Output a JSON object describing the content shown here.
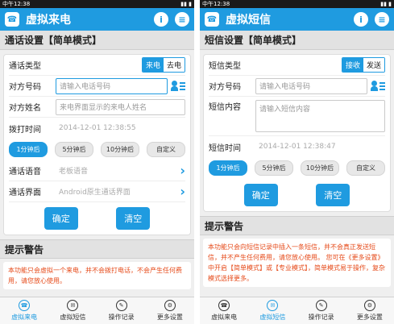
{
  "status": {
    "time": "中午12:38",
    "indicators": "▮▮ ▮"
  },
  "left": {
    "title": "虚拟来电",
    "section": "通话设置【简单模式】",
    "type_label": "通话类型",
    "type_on": "来电",
    "type_off": "去电",
    "number_label": "对方号码",
    "number_placeholder": "请输入电话号码",
    "name_label": "对方姓名",
    "name_placeholder": "来电界面显示的来电人姓名",
    "time_label": "拨打时间",
    "time_value": "2014-12-01 12:38:55",
    "chips": [
      "1分钟后",
      "5分钟后",
      "10分钟后",
      "自定义"
    ],
    "voice_label": "通话语音",
    "voice_value": "老板语音",
    "ui_label": "通话界面",
    "ui_value": "Android原生通话界面",
    "confirm": "确定",
    "clear": "清空",
    "warn_title": "提示警告",
    "warn_text": "本功能只会虚拟一个来电，并不会拨打电话，不会产生任何费用，请您放心使用。"
  },
  "right": {
    "title": "虚拟短信",
    "section": "短信设置【简单模式】",
    "type_label": "短信类型",
    "type_on": "接收",
    "type_off": "发送",
    "number_label": "对方号码",
    "number_placeholder": "请输入电话号码",
    "content_label": "短信内容",
    "content_placeholder": "请输入短信内容",
    "time_label": "短信时间",
    "time_value": "2014-12-01 12:38:47",
    "chips": [
      "1分钟后",
      "5分钟后",
      "10分钟后",
      "自定义"
    ],
    "confirm": "确定",
    "clear": "清空",
    "warn_title": "提示警告",
    "warn_text": "本功能只会向短信记录中插入一条短信，并不会真正发送短信，并不产生任何费用，请您放心使用。  您可在《更多设置》中开启【简单模式】或【专业模式】，简单模式易于操作，复杂模式选择更多。"
  },
  "nav": [
    "虚拟来电",
    "虚拟短信",
    "操作记录",
    "更多设置"
  ],
  "icons": {
    "info": "i",
    "sms": "≡"
  },
  "colors": {
    "accent": "#1f9be0",
    "warning": "#e64a19"
  }
}
